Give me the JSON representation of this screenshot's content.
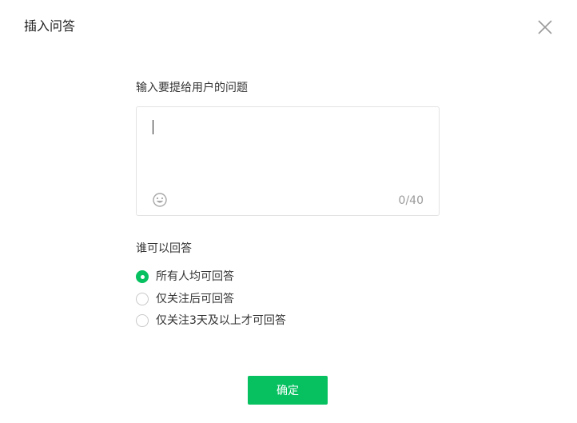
{
  "dialog": {
    "title": "插入问答",
    "close_icon": "close-icon"
  },
  "question": {
    "label": "输入要提给用户的问题",
    "value": "",
    "placeholder": "",
    "counter": "0/40",
    "emoji_icon": "emoji-icon"
  },
  "answer_scope": {
    "label": "谁可以回答",
    "options": [
      {
        "label": "所有人均可回答",
        "checked": true
      },
      {
        "label": "仅关注后可回答",
        "checked": false
      },
      {
        "label": "仅关注3天及以上才可回答",
        "checked": false
      }
    ]
  },
  "footer": {
    "confirm_label": "确定"
  },
  "colors": {
    "accent": "#07c160",
    "border": "#e3e3e3",
    "muted_text": "#9a9a9a"
  }
}
